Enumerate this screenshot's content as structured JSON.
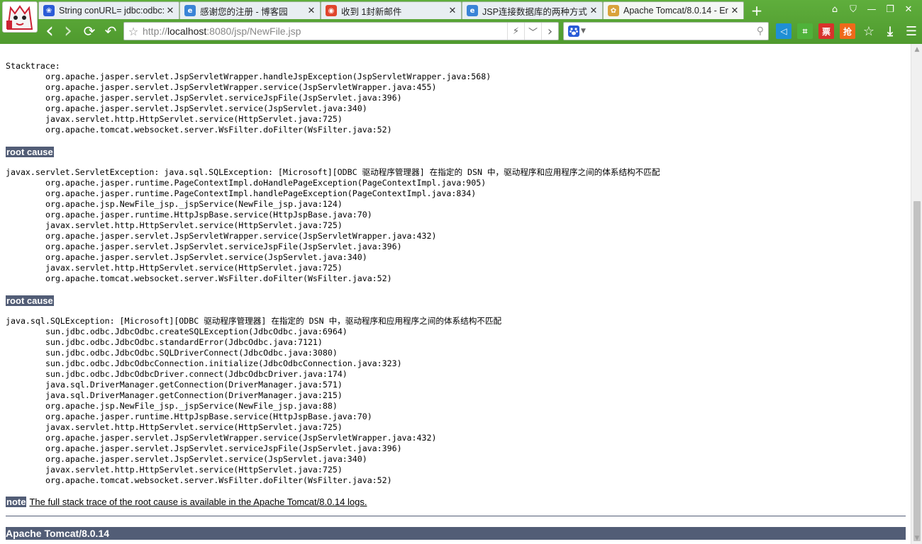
{
  "browser": {
    "tabs": [
      {
        "title": "String conURL= jdbc:odbc:",
        "icon": "baidu-paw-icon",
        "color": "#2a5bd7"
      },
      {
        "title": "感谢您的注册 - 博客园",
        "icon": "browser-e-icon",
        "color": "#3a84d6"
      },
      {
        "title": "收到 1封新邮件",
        "icon": "chrome-icon",
        "color": "#e0452c"
      },
      {
        "title": "JSP连接数据库的两种方式",
        "icon": "browser-e-icon",
        "color": "#3a84d6"
      },
      {
        "title": "Apache Tomcat/8.0.14 - Er",
        "icon": "tomcat-icon",
        "color": "#d9a23a"
      }
    ],
    "new_tab": "+",
    "window_controls": {
      "skin": "⌂",
      "shirt": "⛉",
      "minimize": "—",
      "maximize": "❐",
      "close": "✕"
    },
    "nav": {
      "back": "‹",
      "forward": "›",
      "refresh": "⟳",
      "undo": "↶"
    },
    "url": {
      "prefix": "http://",
      "host": "localhost",
      "rest": ":8080/jsp/NewFile.jsp"
    },
    "url_actions": {
      "lightning": "⚡",
      "dropdown": "﹀",
      "go": "›"
    },
    "search_engine": "baidu-paw-icon",
    "toolbar_icons": [
      {
        "name": "sidebar-icon",
        "glyph": "◁",
        "color": "#1f8fd6"
      },
      {
        "name": "crop-icon",
        "glyph": "⌗",
        "color": "#4fb23a"
      },
      {
        "name": "ticket-icon",
        "glyph": "票",
        "color": "#d8322b"
      },
      {
        "name": "grab-icon",
        "glyph": "抢",
        "color": "#ef6a1a"
      },
      {
        "name": "favorites-icon",
        "glyph": "☆",
        "color": "transparent"
      },
      {
        "name": "download-icon",
        "glyph": "⤓",
        "color": "transparent"
      },
      {
        "name": "menu-icon",
        "glyph": "☰",
        "color": "transparent"
      }
    ]
  },
  "page": {
    "stacktrace_header": "Stacktrace:",
    "stacktrace_lines": [
      "org.apache.jasper.servlet.JspServletWrapper.handleJspException(JspServletWrapper.java:568)",
      "org.apache.jasper.servlet.JspServletWrapper.service(JspServletWrapper.java:455)",
      "org.apache.jasper.servlet.JspServlet.serviceJspFile(JspServlet.java:396)",
      "org.apache.jasper.servlet.JspServlet.service(JspServlet.java:340)",
      "javax.servlet.http.HttpServlet.service(HttpServlet.java:725)",
      "org.apache.tomcat.websocket.server.WsFilter.doFilter(WsFilter.java:52)"
    ],
    "root_cause_label": "root cause",
    "cause1_header": "javax.servlet.ServletException: java.sql.SQLException: [Microsoft][ODBC 驱动程序管理器] 在指定的 DSN 中，驱动程序和应用程序之间的体系结构不匹配",
    "cause1_lines": [
      "org.apache.jasper.runtime.PageContextImpl.doHandlePageException(PageContextImpl.java:905)",
      "org.apache.jasper.runtime.PageContextImpl.handlePageException(PageContextImpl.java:834)",
      "org.apache.jsp.NewFile_jsp._jspService(NewFile_jsp.java:124)",
      "org.apache.jasper.runtime.HttpJspBase.service(HttpJspBase.java:70)",
      "javax.servlet.http.HttpServlet.service(HttpServlet.java:725)",
      "org.apache.jasper.servlet.JspServletWrapper.service(JspServletWrapper.java:432)",
      "org.apache.jasper.servlet.JspServlet.serviceJspFile(JspServlet.java:396)",
      "org.apache.jasper.servlet.JspServlet.service(JspServlet.java:340)",
      "javax.servlet.http.HttpServlet.service(HttpServlet.java:725)",
      "org.apache.tomcat.websocket.server.WsFilter.doFilter(WsFilter.java:52)"
    ],
    "cause2_header": "java.sql.SQLException: [Microsoft][ODBC 驱动程序管理器] 在指定的 DSN 中，驱动程序和应用程序之间的体系结构不匹配",
    "cause2_lines": [
      "sun.jdbc.odbc.JdbcOdbc.createSQLException(JdbcOdbc.java:6964)",
      "sun.jdbc.odbc.JdbcOdbc.standardError(JdbcOdbc.java:7121)",
      "sun.jdbc.odbc.JdbcOdbc.SQLDriverConnect(JdbcOdbc.java:3080)",
      "sun.jdbc.odbc.JdbcOdbcConnection.initialize(JdbcOdbcConnection.java:323)",
      "sun.jdbc.odbc.JdbcOdbcDriver.connect(JdbcOdbcDriver.java:174)",
      "java.sql.DriverManager.getConnection(DriverManager.java:571)",
      "java.sql.DriverManager.getConnection(DriverManager.java:215)",
      "org.apache.jsp.NewFile_jsp._jspService(NewFile_jsp.java:88)",
      "org.apache.jasper.runtime.HttpJspBase.service(HttpJspBase.java:70)",
      "javax.servlet.http.HttpServlet.service(HttpServlet.java:725)",
      "org.apache.jasper.servlet.JspServletWrapper.service(JspServletWrapper.java:432)",
      "org.apache.jasper.servlet.JspServlet.serviceJspFile(JspServlet.java:396)",
      "org.apache.jasper.servlet.JspServlet.service(JspServlet.java:340)",
      "javax.servlet.http.HttpServlet.service(HttpServlet.java:725)",
      "org.apache.tomcat.websocket.server.WsFilter.doFilter(WsFilter.java:52)"
    ],
    "note_label": "note",
    "note_text": "The full stack trace of the root cause is available in the Apache Tomcat/8.0.14 logs.",
    "footer": "Apache Tomcat/8.0.14"
  },
  "colors": {
    "tomcat_bar": "#525d76",
    "chrome_green": "#5fae3c"
  }
}
